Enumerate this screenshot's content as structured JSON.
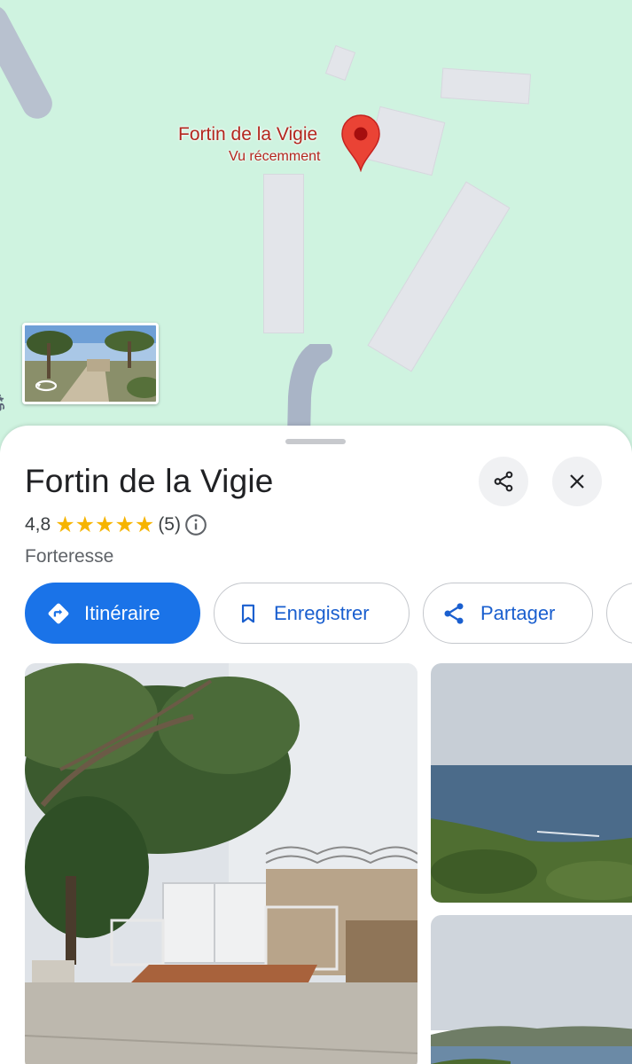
{
  "map": {
    "marker_title": "Fortin de la Vigie",
    "marker_subtitle": "Vu récemment",
    "road_label": "Forts",
    "colors": {
      "land": "#cff3e0",
      "building": "#e3e5ea",
      "road": "#a9b4c6",
      "marker": "#ea4335"
    },
    "street_view_icon": "street-view-rotate-icon"
  },
  "place": {
    "name": "Fortin de la Vigie",
    "rating": "4,8",
    "stars": 5,
    "review_count": "(5)",
    "category": "Forteresse"
  },
  "header_actions": {
    "share_icon": "share-icon",
    "close_icon": "close-icon"
  },
  "actions": {
    "directions_label": "Itinéraire",
    "save_label": "Enregistrer",
    "share_label": "Partager",
    "directions_color": "#1a73e8"
  },
  "photos": {
    "main": "fort-gate-photo",
    "sea_1": "sea-hillside-photo",
    "sea_2": "bay-coast-photo"
  }
}
